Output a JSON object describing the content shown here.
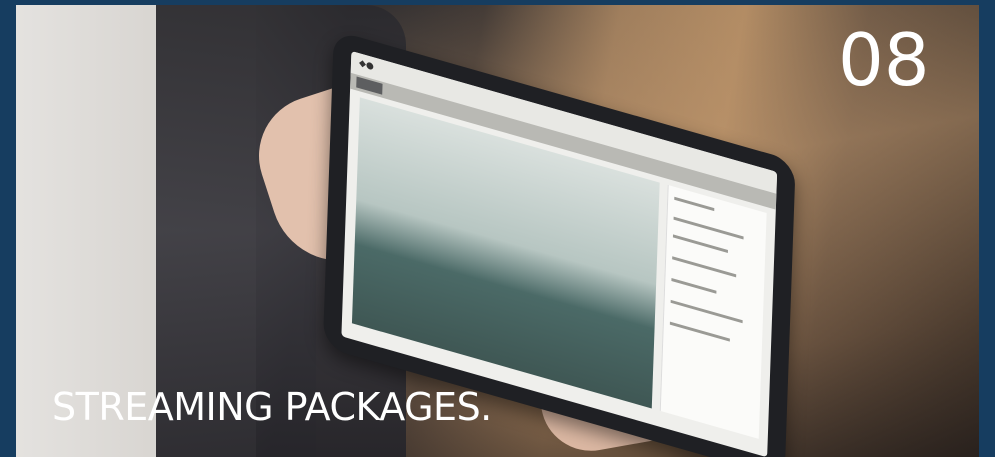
{
  "number": "08",
  "headline": "STREAMING PACKAGES.",
  "colors": {
    "frame": "#163d60",
    "text": "#ffffff"
  }
}
